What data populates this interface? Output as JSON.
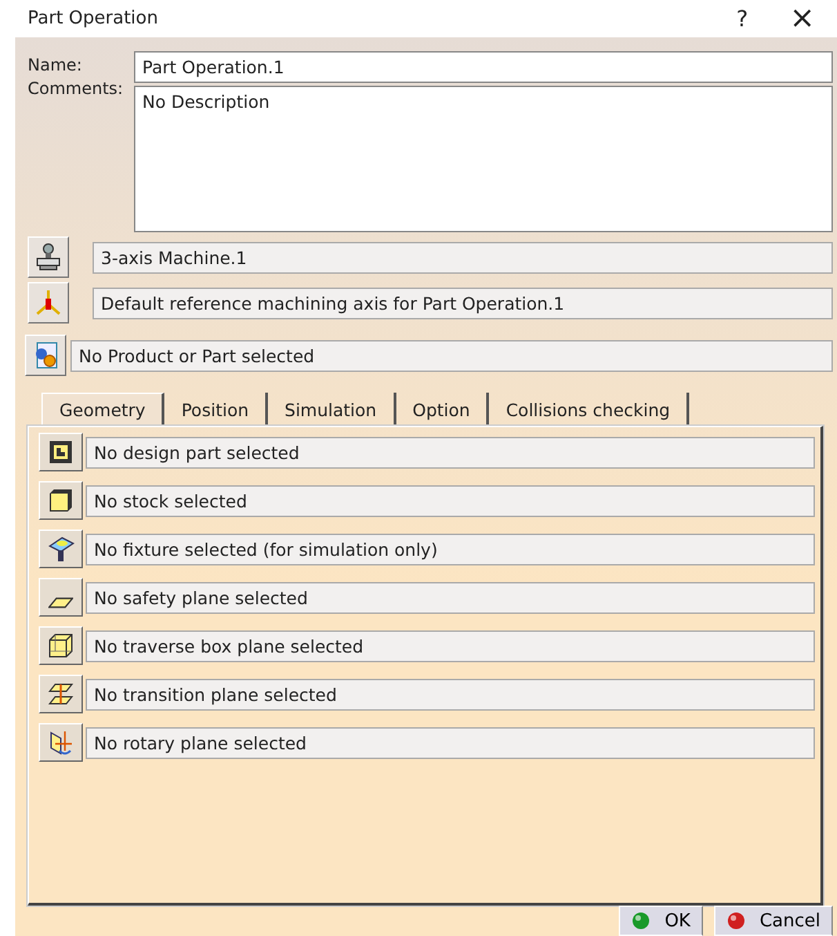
{
  "window": {
    "title": "Part Operation",
    "help": "?",
    "close": "×"
  },
  "name": {
    "label": "Name:",
    "value": "Part Operation.1"
  },
  "comments": {
    "label": "Comments:",
    "value": "No Description"
  },
  "machine": {
    "value": "3-axis Machine.1"
  },
  "axis": {
    "value": "Default reference machining axis for Part Operation.1"
  },
  "product": {
    "value": "No Product or Part selected"
  },
  "tabs": [
    {
      "label": "Geometry",
      "selected": true
    },
    {
      "label": "Position",
      "selected": false
    },
    {
      "label": "Simulation",
      "selected": false
    },
    {
      "label": "Option",
      "selected": false
    },
    {
      "label": "Collisions checking",
      "selected": false
    }
  ],
  "geometry_rows": [
    {
      "kind": "design",
      "text": "No design part selected"
    },
    {
      "kind": "stock",
      "text": "No stock selected"
    },
    {
      "kind": "fixture",
      "text": "No fixture selected (for simulation only)"
    },
    {
      "kind": "safety",
      "text": "No safety plane selected"
    },
    {
      "kind": "traverse",
      "text": "No traverse box plane selected"
    },
    {
      "kind": "transition",
      "text": "No transition plane selected"
    },
    {
      "kind": "rotary",
      "text": "No rotary plane selected"
    }
  ],
  "buttons": [
    {
      "kind": "ok",
      "label": "OK"
    },
    {
      "kind": "cancel",
      "label": "Cancel"
    }
  ]
}
